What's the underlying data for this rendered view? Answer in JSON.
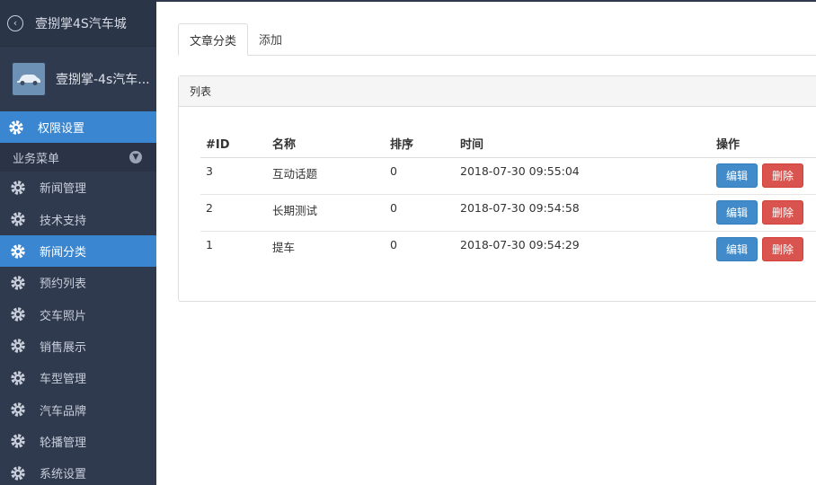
{
  "brand": {
    "title": "壹捌掌4S汽车城"
  },
  "user": {
    "name": "壹捌掌-4s汽车..."
  },
  "sidebar": {
    "top_item": {
      "label": "权限设置",
      "icon": "gear-icon"
    },
    "group": {
      "label": "业务菜单"
    },
    "items": [
      {
        "label": "新闻管理"
      },
      {
        "label": "技术支持"
      },
      {
        "label": "新闻分类"
      },
      {
        "label": "预约列表"
      },
      {
        "label": "交车照片"
      },
      {
        "label": "销售展示"
      },
      {
        "label": "车型管理"
      },
      {
        "label": "汽车品牌"
      },
      {
        "label": "轮播管理"
      },
      {
        "label": "系统设置"
      }
    ],
    "active_index": 2
  },
  "tabs": [
    {
      "label": "文章分类"
    },
    {
      "label": "添加"
    }
  ],
  "panel": {
    "title": "列表"
  },
  "table": {
    "headers": [
      "#ID",
      "名称",
      "排序",
      "时间",
      "操作"
    ],
    "rows": [
      {
        "id": "3",
        "name": "互动话题",
        "sort": "0",
        "time": "2018-07-30 09:55:04"
      },
      {
        "id": "2",
        "name": "长期测试",
        "sort": "0",
        "time": "2018-07-30 09:54:58"
      },
      {
        "id": "1",
        "name": "提车",
        "sort": "0",
        "time": "2018-07-30 09:54:29"
      }
    ],
    "edit_label": "编辑",
    "delete_label": "删除"
  },
  "colors": {
    "sidebar_bg": "#2f3a4e",
    "active_blue": "#3b86d0",
    "edit_button": "#428bca",
    "delete_button": "#d9534f"
  }
}
